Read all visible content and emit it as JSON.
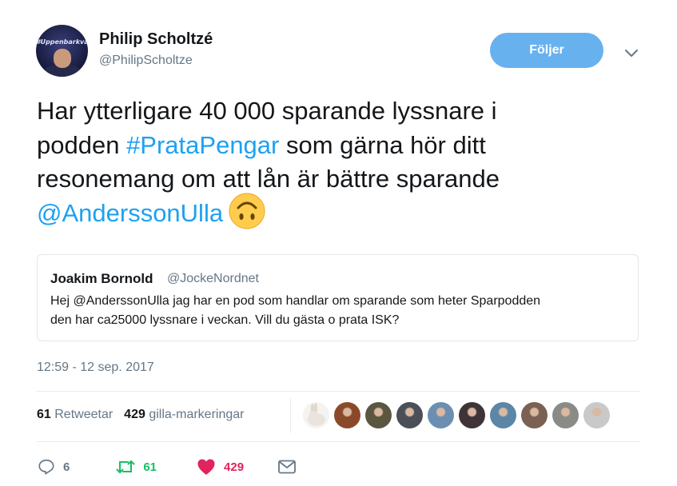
{
  "author": {
    "name": "Philip Scholtzé",
    "handle": "@PhilipScholtze",
    "avatar_text": "#Uppenbarkvall"
  },
  "follow_label": "Följer",
  "tweet": {
    "line1": "Har ytterligare 40 000 sparande lyssnare i",
    "line2_pre": "podden ",
    "hashtag": "#PrataPengar",
    "line2_post": " som gärna hör ditt",
    "line3": "resonemang om att lån är bättre sparande",
    "mention": "@AnderssonUlla",
    "emoji": "upside-down-face-emoji"
  },
  "quote": {
    "name": "Joakim Bornold",
    "handle": "@JockeNordnet",
    "line1": "Hej @AnderssonUlla jag har en pod som handlar om sparande som heter Sparpodden",
    "line2": "den har ca25000 lyssnare i veckan. Vill du gästa o prata ISK?"
  },
  "timestamp": "12:59 - 12 sep. 2017",
  "stats": {
    "retweets_count": "61",
    "retweets_label": "Retweetar",
    "likes_count": "429",
    "likes_label": "gilla-markeringar"
  },
  "likers": [
    {
      "name": "liker-rabbit",
      "color": "#e9e4de"
    },
    {
      "name": "liker-2",
      "color": "#8a4a2a"
    },
    {
      "name": "liker-3",
      "color": "#5b5640"
    },
    {
      "name": "liker-4",
      "color": "#4a4f58"
    },
    {
      "name": "liker-5",
      "color": "#6b8fb0"
    },
    {
      "name": "liker-6",
      "color": "#3e3438"
    },
    {
      "name": "liker-7",
      "color": "#5b86a8"
    },
    {
      "name": "liker-8",
      "color": "#7a6152"
    },
    {
      "name": "liker-9",
      "color": "#8a8a86"
    },
    {
      "name": "liker-10",
      "color": "#c9c9c9"
    }
  ],
  "actions": {
    "reply_count": "6",
    "retweet_count": "61",
    "like_count": "429"
  },
  "colors": {
    "link": "#1da1f2",
    "follow_button": "#68b1ef",
    "retweet_green": "#17bf63",
    "like_red": "#e0245e",
    "muted": "#657786"
  }
}
